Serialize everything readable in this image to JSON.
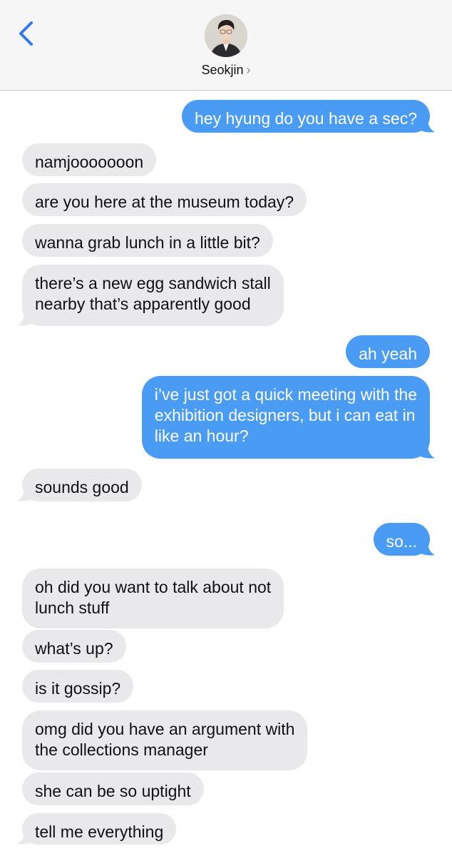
{
  "header": {
    "back_icon": "chevron-left-icon",
    "contact_name": "Seokjin",
    "contact_chevron": "›",
    "accent_color": "#3478f6"
  },
  "colors": {
    "incoming_bubble": "#e9e9eb",
    "outgoing_bubble": "#4a9bf3"
  },
  "messages": [
    {
      "dir": "out",
      "text": "hey hyung do you have a sec?"
    },
    {
      "dir": "in",
      "text": "namjooooooon"
    },
    {
      "dir": "in",
      "text": "are you here at the museum today?"
    },
    {
      "dir": "in",
      "text": "wanna grab lunch in a little bit?"
    },
    {
      "dir": "in",
      "text": "there’s a new egg sandwich stall\nnearby that’s apparently good"
    },
    {
      "dir": "out",
      "text": "ah yeah"
    },
    {
      "dir": "out",
      "text": "i’ve just got a quick meeting with the\nexhibition designers, but i can eat in\nlike an hour?"
    },
    {
      "dir": "in",
      "text": "sounds good"
    },
    {
      "dir": "out",
      "text": "so..."
    },
    {
      "dir": "in",
      "text": "oh did you want to talk about not\nlunch stuff"
    },
    {
      "dir": "in",
      "text": "what’s up?"
    },
    {
      "dir": "in",
      "text": "is it gossip?"
    },
    {
      "dir": "in",
      "text": "omg did you have an argument with\nthe collections manager"
    },
    {
      "dir": "in",
      "text": "she can be so uptight"
    },
    {
      "dir": "in",
      "text": "tell me everything"
    }
  ]
}
